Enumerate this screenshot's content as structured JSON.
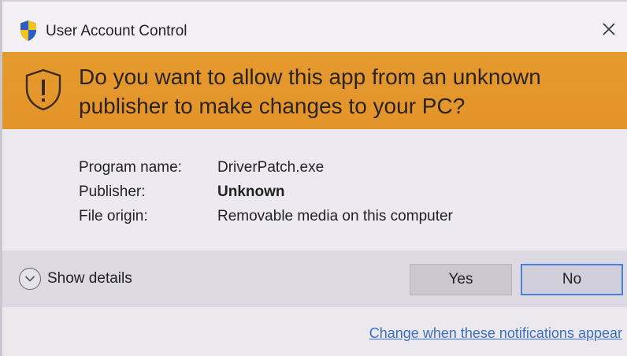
{
  "window": {
    "title": "User Account Control",
    "title_icon": "uac-shield-icon",
    "close_icon": "close-icon"
  },
  "banner": {
    "icon": "warning-shield-icon",
    "heading": "Do you want to allow this app from an unknown publisher to make changes to your PC?",
    "color": "#e59a2e"
  },
  "info": {
    "rows": [
      {
        "label": "Program name:",
        "value": "DriverPatch.exe"
      },
      {
        "label": "Publisher:",
        "value": "Unknown"
      },
      {
        "label": "File origin:",
        "value": "Removable media on this computer"
      }
    ]
  },
  "actions": {
    "details_icon": "chevron-down-icon",
    "details_label": "Show details",
    "yes_label": "Yes",
    "no_label": "No"
  },
  "footer": {
    "link_text": "Change when these notifications appear",
    "link_color": "#3b6fc6"
  }
}
